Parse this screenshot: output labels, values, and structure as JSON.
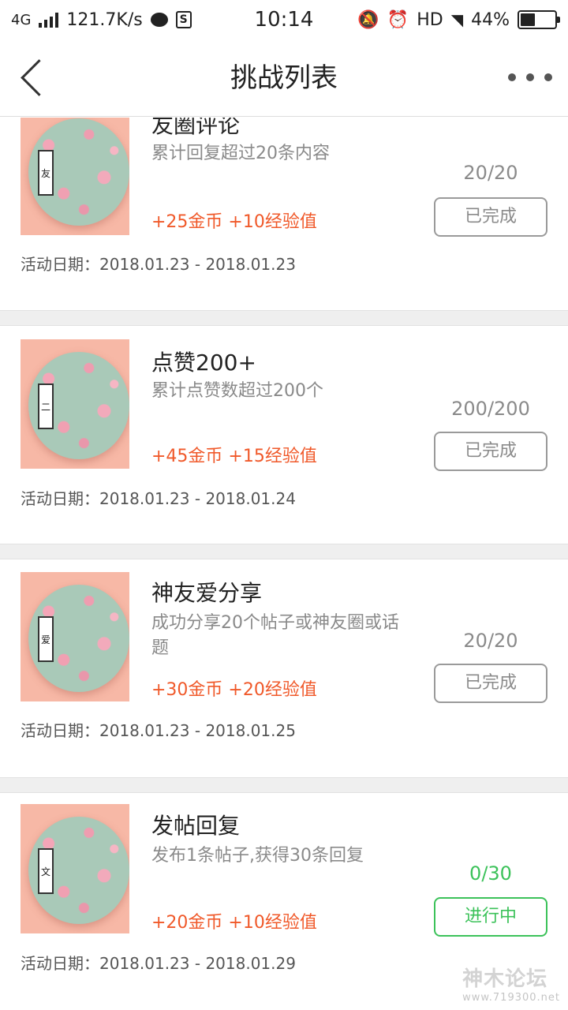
{
  "status_bar": {
    "network": "4G",
    "speed": "121.7K/s",
    "time": "10:14",
    "hd": "HD",
    "battery_percent": "44%",
    "battery_level": 0.44
  },
  "nav": {
    "title": "挑战列表"
  },
  "tasks": [
    {
      "title": "友圈评论",
      "desc": "累计回复超过20条内容",
      "reward": "+25金币 +10经验值",
      "progress": "20/20",
      "button": "已完成",
      "date": "活动日期：2018.01.23 - 2018.01.23",
      "state": "completed"
    },
    {
      "title": "点赞200+",
      "desc": "累计点赞数超过200个",
      "reward": "+45金币 +15经验值",
      "progress": "200/200",
      "button": "已完成",
      "date": "活动日期：2018.01.23 - 2018.01.24",
      "state": "completed"
    },
    {
      "title": "神友爱分享",
      "desc": "成功分享20个帖子或神友圈或话题",
      "reward": "+30金币 +20经验值",
      "progress": "20/20",
      "button": "已完成",
      "date": "活动日期：2018.01.23 - 2018.01.25",
      "state": "completed"
    },
    {
      "title": "发帖回复",
      "desc": "发布1条帖子,获得30条回复",
      "reward": "+20金币 +10经验值",
      "progress": "0/30",
      "button": "进行中",
      "date": "活动日期：2018.01.23 - 2018.01.29",
      "state": "in_progress"
    }
  ],
  "watermark": {
    "text": "神木论坛",
    "url": "www.719300.net"
  },
  "colors": {
    "reward": "#f0592a",
    "in_progress": "#3cc25a",
    "completed": "#8a8a8a"
  }
}
